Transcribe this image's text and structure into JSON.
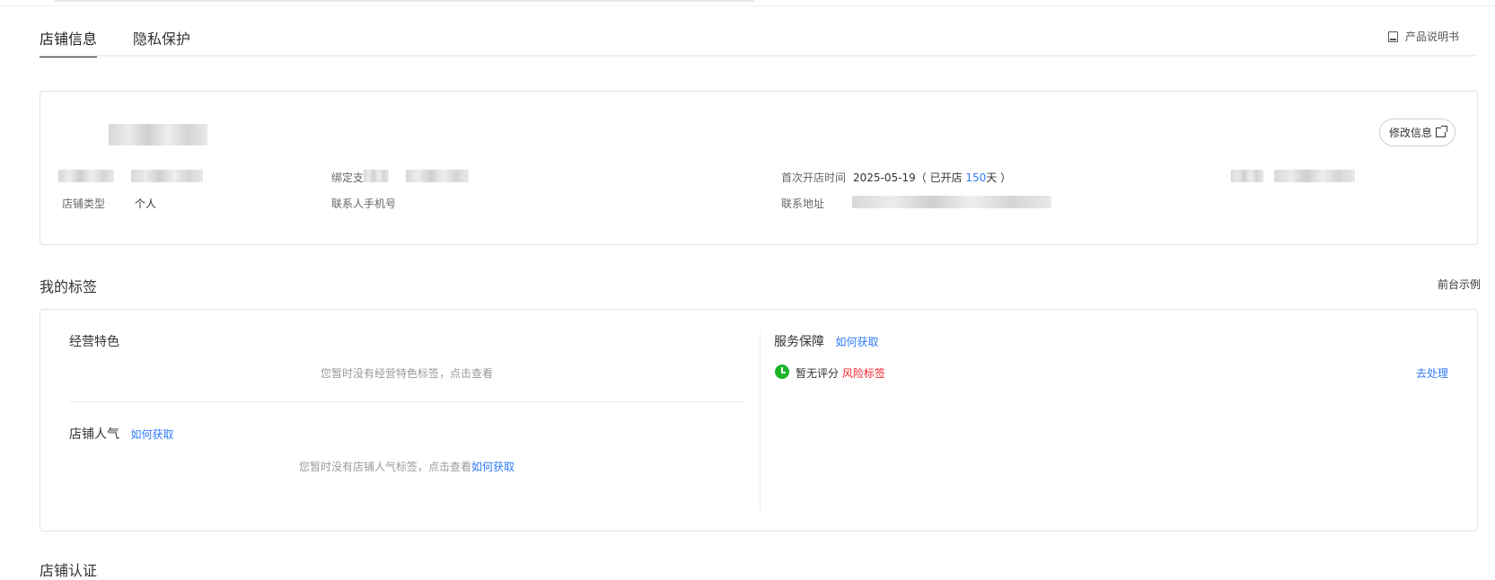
{
  "tabs": [
    {
      "label": "店铺信息",
      "active": true
    },
    {
      "label": "隐私保护",
      "active": false
    }
  ],
  "header": {
    "manual_label": "产品说明书",
    "manual_icon": "book-icon"
  },
  "info": {
    "edit_button": "修改信息",
    "bind_label": "绑定支",
    "first_open_label": "首次开店时间",
    "first_open_date": "2025-05-19",
    "open_prefix": "（ 已开店 ",
    "open_days": "150",
    "open_suffix": "天 ）",
    "shop_type_label": "店铺类型",
    "shop_type_value": "个人",
    "contact_phone_label": "联系人手机号",
    "contact_address_label": "联系地址"
  },
  "tags_section": {
    "title": "我的标签",
    "demo_link": "前台示例",
    "business_title": "经营特色",
    "business_empty": "您暂时没有经营特色标签，点击查看",
    "popularity_title": "店铺人气",
    "popularity_link": "如何获取",
    "popularity_empty": "您暂时没有店铺人气标签，点击查看",
    "popularity_empty_link": "如何获取",
    "service_title": "服务保障",
    "service_link": "如何获取",
    "service_status": "暂无评分",
    "service_risk": "风险标签",
    "service_action": "去处理"
  },
  "cert_section": {
    "title": "店铺认证"
  },
  "colors": {
    "accent": "#2f7cf6",
    "risk": "#f5222d",
    "success": "#1db42a"
  }
}
